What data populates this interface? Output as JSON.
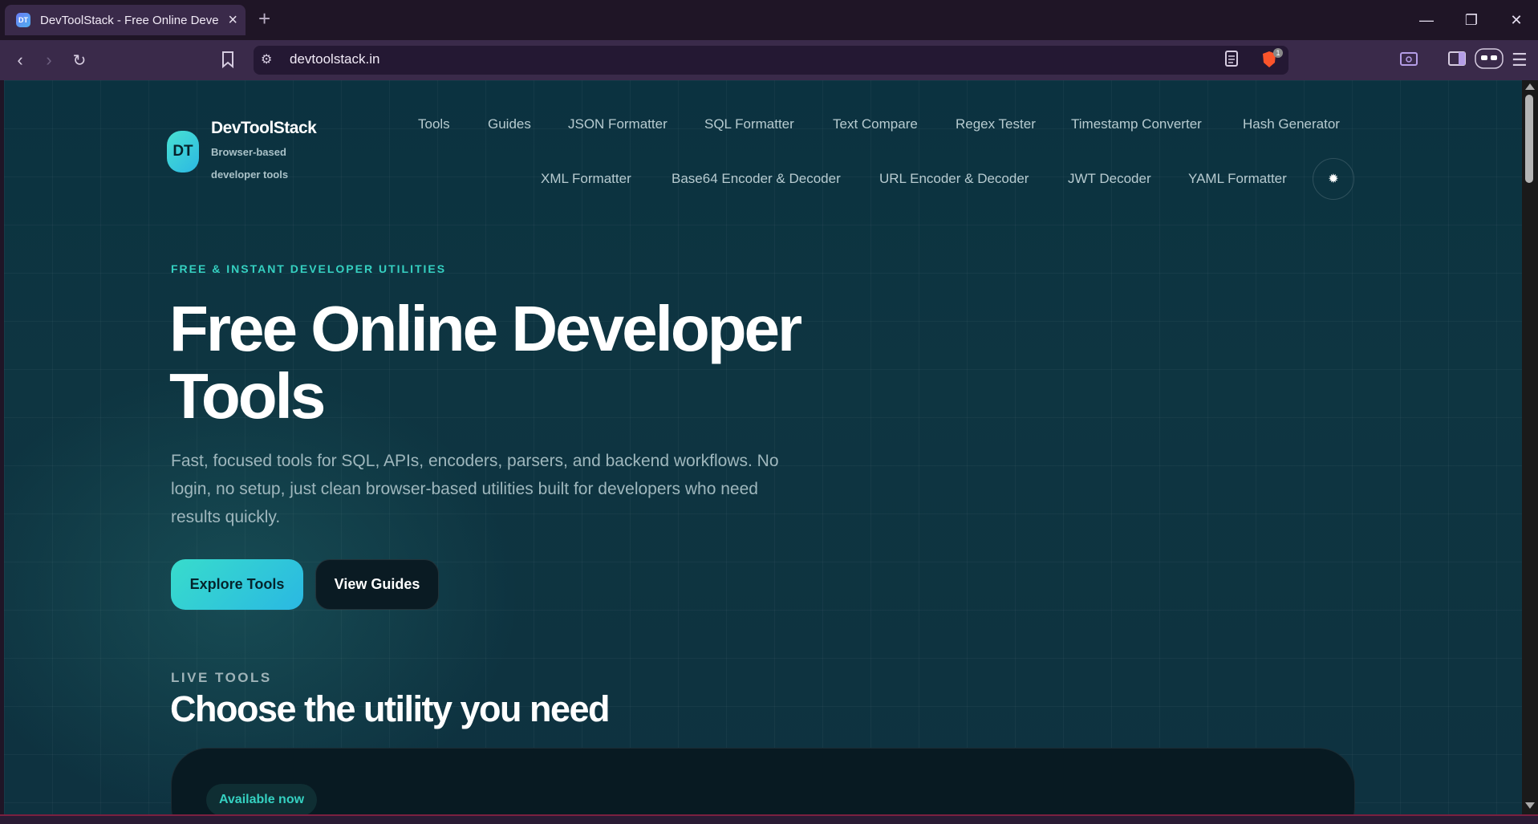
{
  "browser": {
    "tab_title": "DevToolStack - Free Online Deve",
    "tab_favicon": "DT",
    "url": "devtoolstack.in",
    "shield_badge": "1"
  },
  "header": {
    "logo": "DT",
    "brand_name": "DevToolStack",
    "brand_tagline": "Browser-based developer tools",
    "nav_row1": [
      "Tools",
      "Guides",
      "JSON Formatter",
      "SQL Formatter",
      "Text Compare",
      "Regex Tester",
      "Timestamp Converter",
      "Hash Generator"
    ],
    "nav_row2": [
      "XML Formatter",
      "Base64 Encoder & Decoder",
      "URL Encoder & Decoder",
      "JWT Decoder",
      "YAML Formatter"
    ],
    "theme_icon": "sun-icon"
  },
  "hero": {
    "eyebrow": "FREE & INSTANT DEVELOPER UTILITIES",
    "title": "Free Online Developer Tools",
    "description": "Fast, focused tools for SQL, APIs, encoders, parsers, and backend workflows. No login, no setup, just clean browser-based utilities built for developers who need results quickly.",
    "primary_cta": "Explore Tools",
    "secondary_cta": "View Guides"
  },
  "tools_section": {
    "eyebrow": "LIVE TOOLS",
    "title": "Choose the utility you need",
    "badge": "Available now"
  },
  "colors": {
    "accent": "#35d1c1",
    "page_bg": "#0e3541",
    "browser_chrome": "#3a2a4a"
  }
}
